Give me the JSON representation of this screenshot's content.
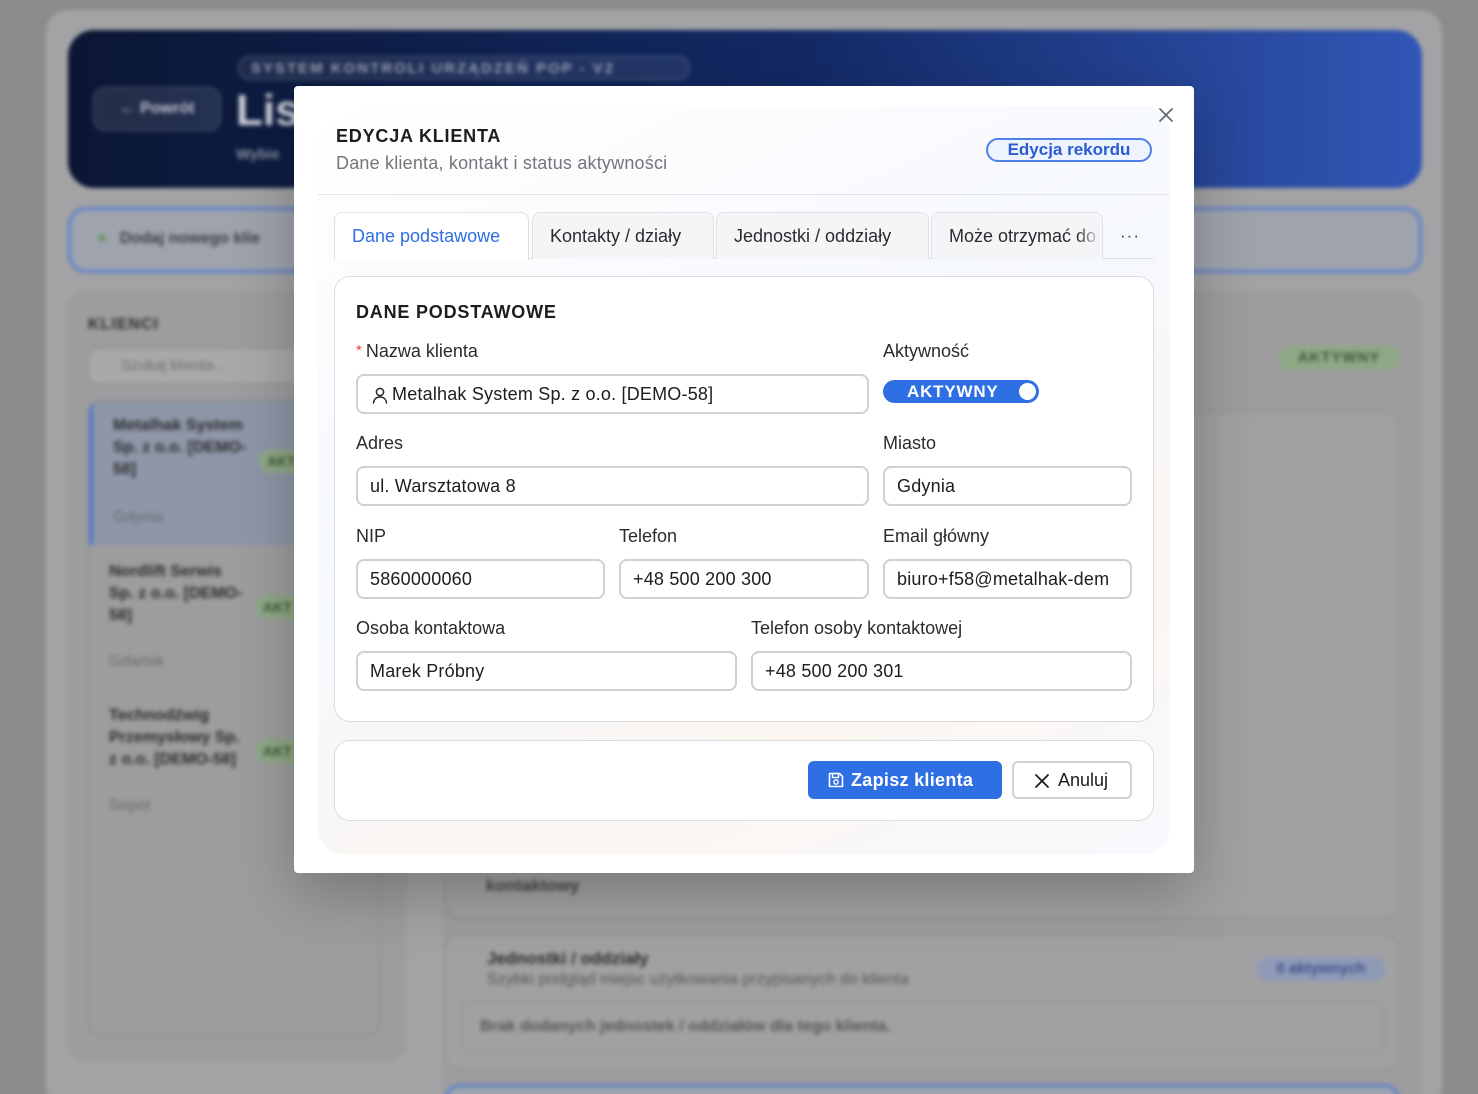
{
  "background": {
    "hero_tag": "SYSTEM KONTROLI URZĄDZEŃ POP - V2",
    "back_label": "Powrót",
    "hero_title": "Lis",
    "hero_subtitle": "Wybie",
    "add_client_label": "Dodaj nowego klie",
    "clients_title": "KLIENCI",
    "search_placeholder": "Szukaj klienta...",
    "clients": [
      {
        "name": "Metalhak System Sp. z o.o. [DEMO-58]",
        "city": "Gdynia",
        "badge": "AKT"
      },
      {
        "name": "Nordlift Serwis Sp. z o.o. [DEMO-58]",
        "city": "Gdańsk",
        "badge": "AKT"
      },
      {
        "name": "Technodźwig Przemysłowy Sp. z o.o. [DEMO-58]",
        "city": "Sopot",
        "badge": "AKT"
      }
    ],
    "status_badge": "AKTYWNY",
    "contact_fragment": "kontaktowy",
    "units_card": {
      "title": "Jednostki / oddziały",
      "subtitle": "Szybki podgląd miejsc użytkowania przypisanych do klienta",
      "badge": "0 aktywnych",
      "empty": "Brak dodanych jednostek / oddziałów dla tego klienta."
    }
  },
  "modal": {
    "title": "EDYCJA KLIENTA",
    "subtitle": "Dane klienta, kontakt i status aktywności",
    "badge": "Edycja rekordu",
    "tabs": [
      {
        "label": "Dane podstawowe",
        "active": true
      },
      {
        "label": "Kontakty / działy",
        "active": false
      },
      {
        "label": "Jednostki / oddziały",
        "active": false
      },
      {
        "label": "Może otrzymać do",
        "active": false
      }
    ],
    "more_tabs": "···",
    "section_title": "DANE PODSTAWOWE",
    "fields": {
      "client_name": {
        "label": "Nazwa klienta",
        "value": "Metalhak System Sp. z o.o. [DEMO-58]",
        "required": "*"
      },
      "activity": {
        "label": "Aktywność",
        "value": "AKTYWNY"
      },
      "address": {
        "label": "Adres",
        "value": "ul. Warsztatowa 8"
      },
      "city": {
        "label": "Miasto",
        "value": "Gdynia"
      },
      "nip": {
        "label": "NIP",
        "value": "5860000060"
      },
      "phone": {
        "label": "Telefon",
        "value": "+48 500 200 300"
      },
      "email": {
        "label": "Email główny",
        "value": "biuro+f58@metalhak-dem"
      },
      "contact_person": {
        "label": "Osoba kontaktowa",
        "value": "Marek Próbny"
      },
      "contact_phone": {
        "label": "Telefon osoby kontaktowej",
        "value": "+48 500 200 301"
      }
    },
    "save_label": "Zapisz klienta",
    "cancel_label": "Anuluj"
  },
  "colors": {
    "accent": "#2f6fe4",
    "required": "#e0453a",
    "hero_dark": "#0b1633"
  },
  "icons": [
    "close-icon",
    "user-icon",
    "save-icon",
    "x-icon",
    "more-icon"
  ]
}
